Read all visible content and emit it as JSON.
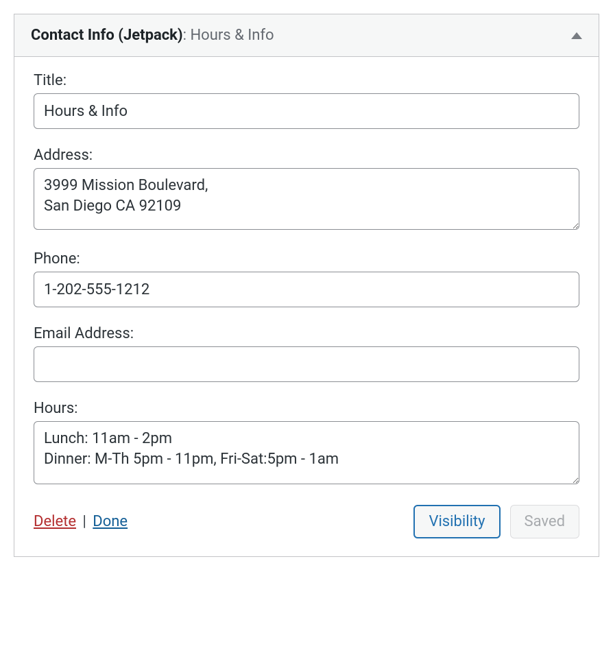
{
  "widget": {
    "title_main": "Contact Info (Jetpack)",
    "title_separator": ": ",
    "title_sub": "Hours & Info"
  },
  "fields": {
    "title": {
      "label": "Title:",
      "value": "Hours & Info"
    },
    "address": {
      "label": "Address:",
      "value": "3999 Mission Boulevard,\nSan Diego CA 92109"
    },
    "phone": {
      "label": "Phone:",
      "value": "1-202-555-1212"
    },
    "email": {
      "label": "Email Address:",
      "value": ""
    },
    "hours": {
      "label": "Hours:",
      "value": "Lunch: 11am - 2pm\nDinner: M-Th 5pm - 11pm, Fri-Sat:5pm - 1am"
    }
  },
  "footer": {
    "delete": "Delete",
    "separator": " | ",
    "done": "Done",
    "visibility": "Visibility",
    "saved": "Saved"
  }
}
